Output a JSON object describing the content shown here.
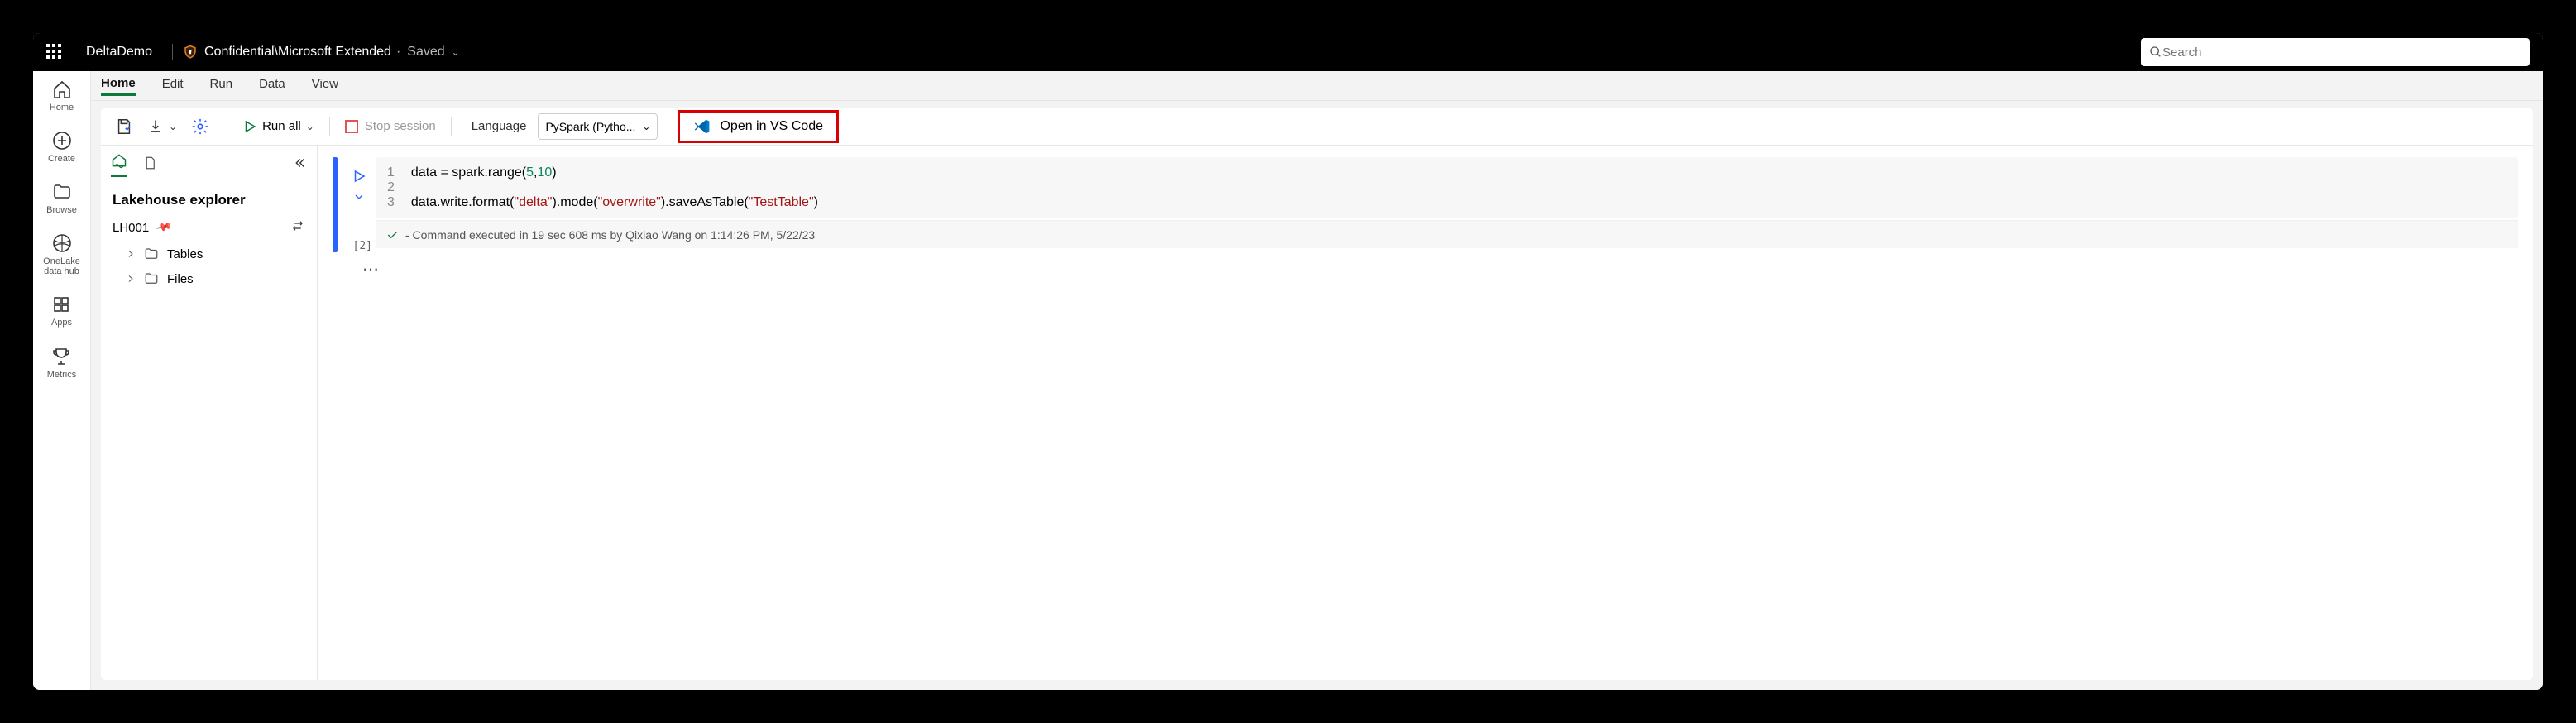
{
  "topbar": {
    "workspace": "DeltaDemo",
    "confidential": "Confidential\\Microsoft Extended",
    "saved": "Saved",
    "search_placeholder": "Search"
  },
  "leftrail": {
    "home": "Home",
    "create": "Create",
    "browse": "Browse",
    "onelake": "OneLake\ndata hub",
    "apps": "Apps",
    "metrics": "Metrics"
  },
  "ribbon": {
    "home": "Home",
    "edit": "Edit",
    "run": "Run",
    "data": "Data",
    "view": "View"
  },
  "toolbar": {
    "run_all": "Run all",
    "stop_session": "Stop session",
    "language_label": "Language",
    "language_value": "PySpark (Pytho...",
    "open_vscode": "Open in VS Code"
  },
  "explorer": {
    "title": "Lakehouse explorer",
    "lakehouse": "LH001",
    "tables": "Tables",
    "files": "Files"
  },
  "cell": {
    "count": "[2]",
    "line1": "1",
    "line2": "2",
    "line3": "3",
    "code_line1_pre": "data = spark.range(",
    "code_line1_n1": "5",
    "code_line1_mid": ",",
    "code_line1_n2": "10",
    "code_line1_post": ")",
    "code_line3_a": "data.write.format(",
    "code_line3_s1": "\"delta\"",
    "code_line3_b": ").mode(",
    "code_line3_s2": "\"overwrite\"",
    "code_line3_c": ").saveAsTable(",
    "code_line3_s3": "\"TestTable\"",
    "code_line3_d": ")",
    "status": "- Command executed in 19 sec 608 ms by Qixiao Wang on 1:14:26 PM, 5/22/23"
  }
}
